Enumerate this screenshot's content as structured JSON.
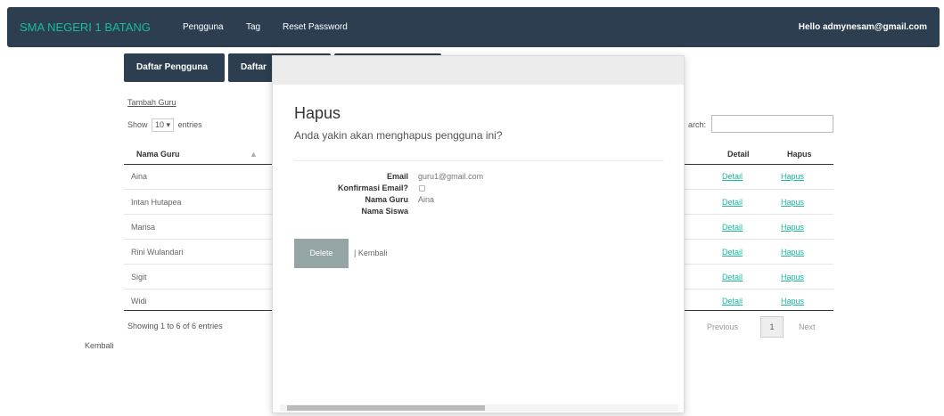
{
  "navbar": {
    "brand": "SMA NEGERI 1 BATANG",
    "links": [
      "Pengguna",
      "Tag",
      "Reset Password"
    ],
    "user": "Hello admynesam@gmail.com"
  },
  "tabs": [
    "Daftar Pengguna",
    "Daftar"
  ],
  "page": {
    "add_link": "Tambah Guru",
    "show_label": "Show",
    "show_value": "10",
    "entries_label": "entries",
    "search_label": "arch:",
    "columns": {
      "name": "Nama Guru",
      "detail": "Detail",
      "hapus": "Hapus"
    },
    "rows": [
      {
        "name": "Aina",
        "detail": "Detail",
        "hapus": "Hapus"
      },
      {
        "name": "Intan Hutapea",
        "detail": "Detail",
        "hapus": "Hapus"
      },
      {
        "name": "Marisa",
        "detail": "Detail",
        "hapus": "Hapus"
      },
      {
        "name": "Rini Wulandari",
        "detail": "Detail",
        "hapus": "Hapus"
      },
      {
        "name": "Sigit",
        "detail": "Detail",
        "hapus": "Hapus"
      },
      {
        "name": "Widi",
        "detail": "Detail",
        "hapus": "Hapus"
      }
    ],
    "info": "Showing 1 to 6 of 6 entries",
    "pagination": {
      "previous": "Previous",
      "current": "1",
      "next": "Next"
    },
    "back": "Kembali"
  },
  "modal": {
    "title": "Hapus",
    "subtitle": "Anda yakin akan menghapus pengguna ini?",
    "fields": {
      "email_label": "Email",
      "email_value": "guru1@gmail.com",
      "confirm_label": "Konfirmasi Email?",
      "guru_label": "Nama Guru",
      "guru_value": "Aina",
      "siswa_label": "Nama Siswa"
    },
    "delete_label": "Delete",
    "back_label": "| Kembali"
  }
}
